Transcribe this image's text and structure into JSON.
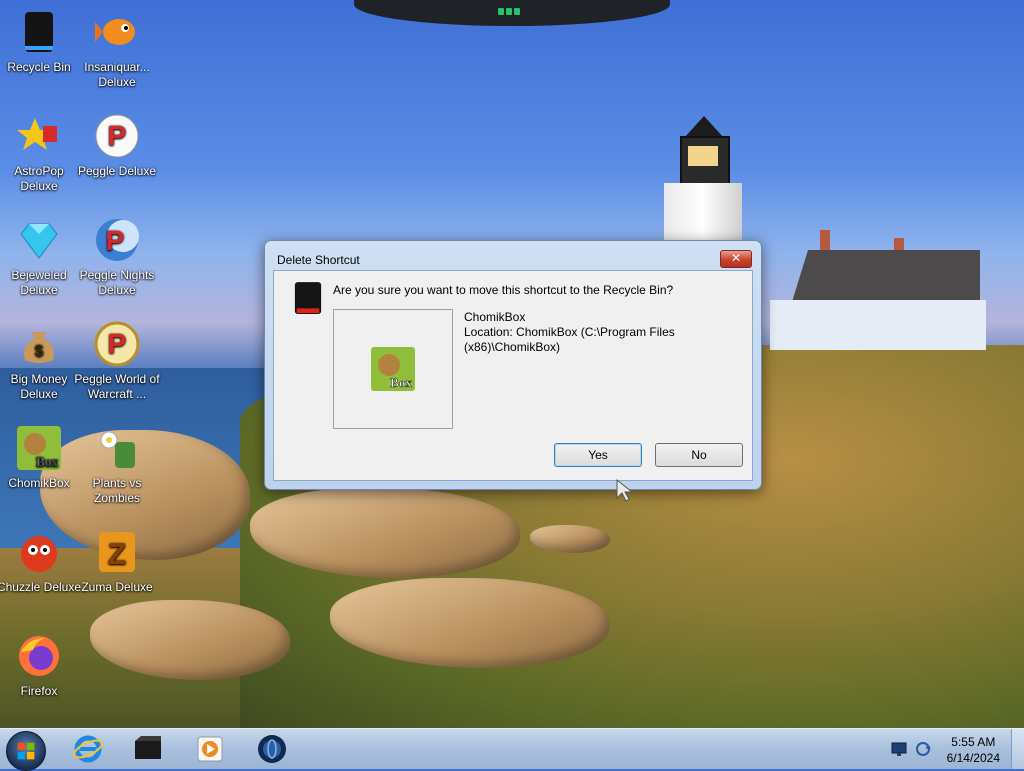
{
  "desktop": {
    "icons": [
      {
        "label": "Recycle Bin",
        "icon": "recycle-bin-icon"
      },
      {
        "label": "Insaniquar... Deluxe",
        "icon": "goldfish-icon"
      },
      {
        "label": "AstroPop Deluxe",
        "icon": "astropop-icon"
      },
      {
        "label": "Peggle Deluxe",
        "icon": "peggle-icon"
      },
      {
        "label": "Bejeweled Deluxe",
        "icon": "gem-icon"
      },
      {
        "label": "Peggle Nights Deluxe",
        "icon": "peggle-nights-icon"
      },
      {
        "label": "Big Money Deluxe",
        "icon": "money-bag-icon"
      },
      {
        "label": "Peggle World of Warcraft ...",
        "icon": "peggle-wow-icon"
      },
      {
        "label": "ChomikBox",
        "icon": "chomikbox-icon"
      },
      {
        "label": "Plants vs Zombies",
        "icon": "plants-vs-zombies-icon"
      },
      {
        "label": "Chuzzle Deluxe",
        "icon": "chuzzle-icon"
      },
      {
        "label": "Zuma Deluxe",
        "icon": "zuma-icon"
      },
      {
        "label": "Firefox",
        "icon": "firefox-icon"
      }
    ]
  },
  "dialog": {
    "title": "Delete Shortcut",
    "close_label": "✕",
    "message": "Are you sure you want to move this shortcut to the Recycle Bin?",
    "item_name": "ChomikBox",
    "item_location": "Location: ChomikBox (C:\\Program Files (x86)\\ChomikBox)",
    "yes_label": "Yes",
    "no_label": "No",
    "preview_icon": "chomikbox-icon",
    "preview_icon_text": "Box"
  },
  "taskbar": {
    "pinned": [
      {
        "icon": "internet-explorer-icon"
      },
      {
        "icon": "black-box-icon"
      },
      {
        "icon": "media-player-icon"
      },
      {
        "icon": "globe-icon"
      }
    ],
    "clock": {
      "time": "5:55 AM",
      "date": "6/14/2024"
    }
  },
  "colors": {
    "dialog_frame": "#bcd2ee",
    "taskbar": "#a8bfdc"
  }
}
